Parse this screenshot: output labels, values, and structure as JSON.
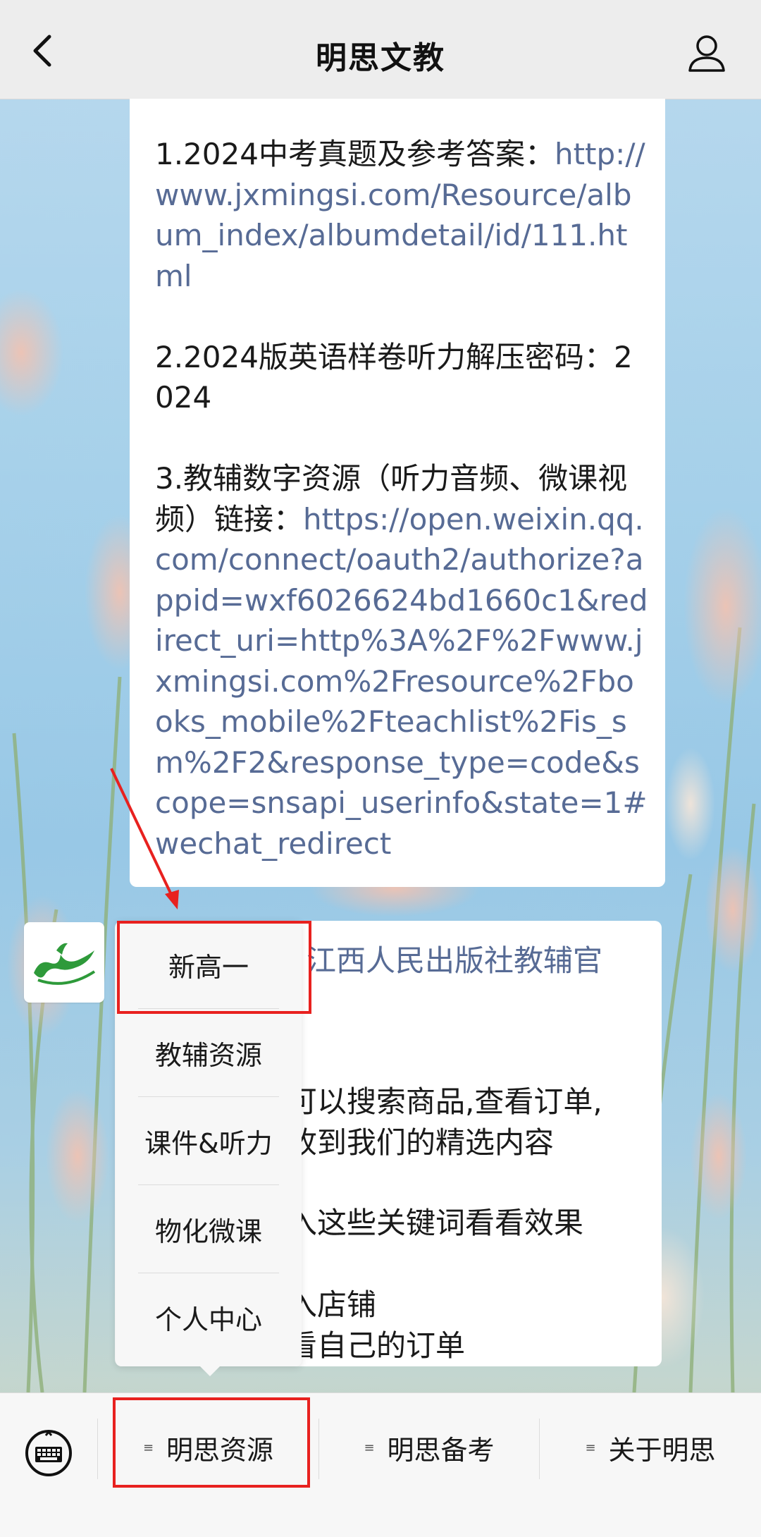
{
  "header": {
    "title": "明思文教",
    "back_icon": "chevron-left-icon",
    "profile_icon": "user-icon"
  },
  "message1": {
    "item1_text": "1.2024中考真题及参考答案：",
    "item1_link": "http://www.jxmingsi.com/Resource/album_index/albumdetail/id/111.html",
    "item2_text": "2.2024版英语样卷听力解压密码：2024",
    "item3_text": "3.教辅数字资源（听力音频、微课视频）链接：",
    "item3_link": "https://open.weixin.qq.com/connect/oauth2/authorize?appid=wxf6026624bd1660c1&redirect_uri=http%3A%2F%2Fwww.jxmingsi.com%2Fresource%2Fbooks_mobile%2Fteachlist%2Fis_sm%2F2&response_type=code&scope=snsapi_userinfo&state=1#wechat_redirect"
  },
  "message2": {
    "line1": "江西人民出版社教辅官",
    "line2": "可以搜索商品,查看订单,",
    "line3": "收到我们的精选内容",
    "line4": "入这些关键词看看效果",
    "line5": "入店铺",
    "line6": "看自己的订单"
  },
  "popup_menu": {
    "items": [
      "新高一",
      "教辅资源",
      "课件&听力",
      "物化微课",
      "个人中心"
    ]
  },
  "bottom_bar": {
    "keyboard_icon": "keyboard-icon",
    "tabs": [
      "明思资源",
      "明思备考",
      "关于明思"
    ]
  },
  "colors": {
    "link": "#576b95",
    "annotation_red": "#e8211f",
    "logo_green": "#2e9a3a"
  }
}
